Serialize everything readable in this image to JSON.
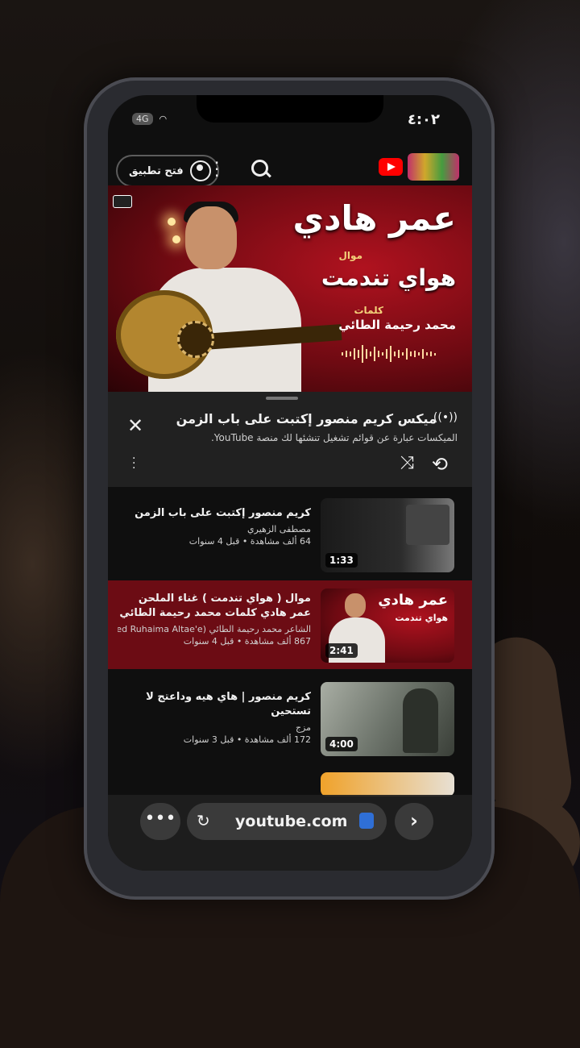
{
  "status": {
    "time": "٤:٠٢",
    "network": "4G"
  },
  "topbar": {
    "open_app_label": "فتح تطبيق"
  },
  "cover": {
    "title": "عمر هادي",
    "subtitle": "موال",
    "song": "هواي تندمت",
    "words_label": "كلمات",
    "poet": "محمد رحيمة الطائي"
  },
  "mix": {
    "title": "ميكس كريم منصور إكتبت على باب الزمن",
    "description": "الميكسات عبارة عن قوائم تشغيل تنشئها لك منصة YouTube."
  },
  "playlist": [
    {
      "title": "كريم منصور إكتبت على باب الزمن",
      "channel": "مصطفى الزهيري",
      "meta": "64 ألف مشاهدة • قبل 4 سنوات",
      "duration": "1:33",
      "active": false
    },
    {
      "title": "موال ( هواي تندمت ) غناء الملحن عمر هادي كلمات محمد رحيمة الطائي",
      "channel": "الشاعر محمد رحيمة الطائي (Mohammed Ruhaima Altae'e)",
      "meta": "867 ألف مشاهدة • قبل 4 سنوات",
      "duration": "2:41",
      "active": true
    },
    {
      "title": "كريم منصور | هاي هيه وداعتج لا تستحين",
      "channel": "مزج",
      "meta": "172 ألف مشاهدة • قبل 3 سنوات",
      "duration": "4:00",
      "active": false
    }
  ],
  "browser": {
    "url": "youtube.com"
  }
}
